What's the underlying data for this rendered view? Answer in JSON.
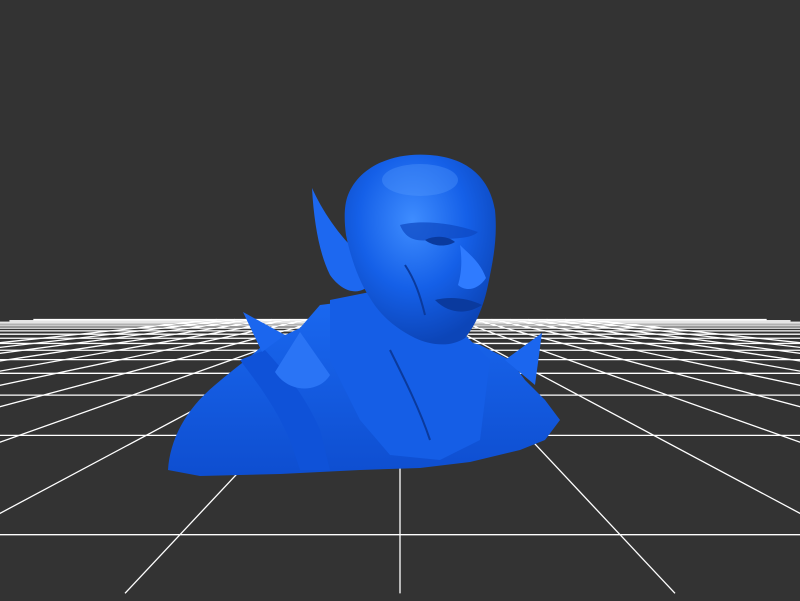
{
  "viewer": {
    "background": "#333333",
    "grid_color": "#ffffff",
    "model_color": "#1560e8",
    "model_highlight": "#3a86ff",
    "model_shadow": "#0b3a9c"
  }
}
